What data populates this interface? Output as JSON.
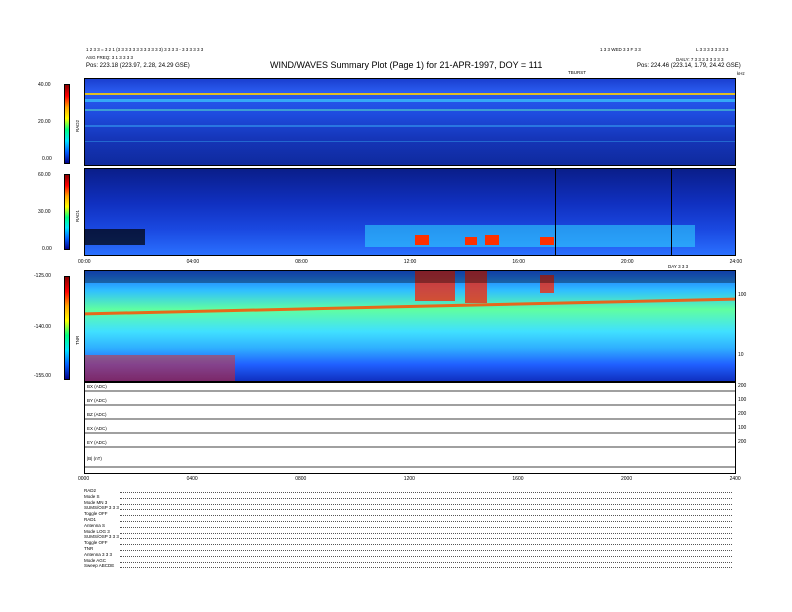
{
  "header": {
    "left_lines": [
      "1 2 3 3 = 3 2 1 (3 3 3 3 3 3 3 3 3 3 3 3) 3 3 3 3 -  3 3 3 3 3 3",
      "ASG FREQ: 3 1 3 3 3 3"
    ],
    "left_pos": "Pos:    223.18 (223.97, 2.28, 24.29 GSE)",
    "title": "WIND/WAVES Summary Plot (Page 1) for 21-APR-1997, DOY = 111",
    "right_top_a": "1 3 3 WED 3 3 F 3 3",
    "right_top_b": "L 3 3 3 3 3 3 3 3",
    "right_mid": "DAILY: 7 3 3 3 3 3 3 3 3",
    "right_pos": "Pos:    224.46 (223.14, 1.79, 24.42 GSE)",
    "sub_marker": "TBURST",
    "corner_mark": "kHz"
  },
  "rad2": {
    "label": "RAD2",
    "ticks": [
      "40.00",
      "20.00",
      "0.00"
    ]
  },
  "rad1": {
    "label": "RAD1",
    "ticks": [
      "60.00",
      "30.00",
      "0.00"
    ]
  },
  "time_axis_top": [
    "00:00",
    "04:00",
    "08:00",
    "12:00",
    "16:00",
    "20:00",
    "24:00"
  ],
  "mid_marker": "DAY 3 3 3",
  "tnr": {
    "label": "TNR",
    "ticks": [
      "-125.00",
      "-140.00",
      "-155.00"
    ],
    "right_ticks": [
      "100",
      "10"
    ]
  },
  "mag_rows": [
    {
      "label": "BX (ADC)"
    },
    {
      "label": "BY (ADC)"
    },
    {
      "label": "BZ (ADC)"
    },
    {
      "label": "EX (ADC)"
    },
    {
      "label": "EY (ADC)"
    },
    {
      "label": "|B| (nT)"
    }
  ],
  "mag_right_ticks": [
    "200",
    "100",
    "200",
    "100",
    "200"
  ],
  "time_axis_bottom": [
    "0000",
    "0400",
    "0800",
    "1200",
    "1600",
    "2000",
    "2400"
  ],
  "modes": [
    {
      "label": "RAD2"
    },
    {
      "label": "Mode          S"
    },
    {
      "label": "Mode  MN 3"
    },
    {
      "label": "SUMS/OSP  3 3 3"
    },
    {
      "label": "Toggle     OFF"
    },
    {
      "label": "RAD1"
    },
    {
      "label": "Antenna     S"
    },
    {
      "label": "Mode  LOG 3"
    },
    {
      "label": "SUMS/OSP  3 3 3"
    },
    {
      "label": "Toggle     OFF"
    },
    {
      "label": "TNR"
    },
    {
      "label": "Antenna   3 3 3"
    },
    {
      "label": "Mode         AGC"
    },
    {
      "label": "Sweep  ABCDE"
    }
  ]
}
